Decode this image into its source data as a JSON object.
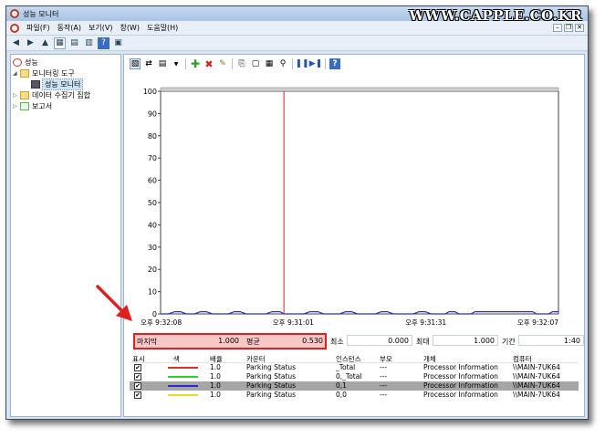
{
  "window": {
    "title": "성능 모니터"
  },
  "watermark": "WWW.CAPPLE.CO.KR",
  "menu": [
    "파일(F)",
    "동작(A)",
    "보기(V)",
    "창(W)",
    "도움말(H)"
  ],
  "tree": {
    "items": [
      {
        "label": "성능",
        "level": 0,
        "icon": "performance-icon"
      },
      {
        "label": "모니터링 도구",
        "level": 1,
        "icon": "folder-icon"
      },
      {
        "label": "성능 모니터",
        "level": 2,
        "icon": "monitor-icon",
        "selected": true
      },
      {
        "label": "데이터 수집기 집합",
        "level": 1,
        "icon": "collector-icon"
      },
      {
        "label": "보고서",
        "level": 1,
        "icon": "report-icon"
      }
    ]
  },
  "stats": {
    "last_label": "마지막",
    "last_value": "1.000",
    "avg_label": "평균",
    "avg_value": "0.530",
    "min_label": "최소",
    "min_value": "0.000",
    "max_label": "최대",
    "max_value": "1.000",
    "duration_label": "기간",
    "duration_value": "1:40"
  },
  "counters": {
    "headers": [
      "표시",
      "색",
      "배율",
      "카운터",
      "인스턴스",
      "부모",
      "개체",
      "컴퓨터"
    ],
    "rows": [
      {
        "show": true,
        "color": "#e03030",
        "scale": "1.0",
        "counter": "Parking Status",
        "instance": "_Total",
        "parent": "---",
        "object": "Processor Information",
        "computer": "\\\\MAIN-7UK64"
      },
      {
        "show": true,
        "color": "#33cc33",
        "scale": "1.0",
        "counter": "Parking Status",
        "instance": "0,_Total",
        "parent": "---",
        "object": "Processor Information",
        "computer": "\\\\MAIN-7UK64"
      },
      {
        "show": true,
        "color": "#2b2bd0",
        "scale": "1.0",
        "counter": "Parking Status",
        "instance": "0,1",
        "parent": "---",
        "object": "Processor Information",
        "computer": "\\\\MAIN-7UK64",
        "selected": true
      },
      {
        "show": true,
        "color": "#e0e020",
        "scale": "1.0",
        "counter": "Parking Status",
        "instance": "0,0",
        "parent": "---",
        "object": "Processor Information",
        "computer": "\\\\MAIN-7UK64"
      }
    ]
  },
  "chart_data": {
    "type": "line",
    "ylim": [
      0,
      100
    ],
    "yticks": [
      0,
      10,
      20,
      30,
      40,
      50,
      60,
      70,
      80,
      90,
      100
    ],
    "x_ticks": [
      "오후 9:32:08",
      "오후 9:31:01",
      "오후 9:31:31",
      "오후 9:32:07"
    ],
    "current_time_fraction": 0.31,
    "series": [
      {
        "color": "#2b2bd0",
        "points": [
          [
            0.0,
            0
          ],
          [
            0.02,
            0
          ],
          [
            0.035,
            1
          ],
          [
            0.05,
            1
          ],
          [
            0.065,
            0
          ],
          [
            0.085,
            0
          ],
          [
            0.1,
            1
          ],
          [
            0.115,
            1
          ],
          [
            0.13,
            0
          ],
          [
            0.17,
            0
          ],
          [
            0.185,
            1
          ],
          [
            0.2,
            1
          ],
          [
            0.215,
            0
          ],
          [
            0.265,
            0
          ],
          [
            0.28,
            1
          ],
          [
            0.3,
            1
          ],
          [
            0.31,
            0
          ],
          [
            0.36,
            0
          ],
          [
            0.375,
            1
          ],
          [
            0.395,
            1
          ],
          [
            0.41,
            0
          ],
          [
            0.45,
            0
          ],
          [
            0.465,
            1
          ],
          [
            0.48,
            1
          ],
          [
            0.495,
            0
          ],
          [
            0.54,
            0
          ],
          [
            0.555,
            1
          ],
          [
            0.57,
            1
          ],
          [
            0.585,
            0
          ],
          [
            0.635,
            0
          ],
          [
            0.65,
            1
          ],
          [
            0.665,
            1
          ],
          [
            0.68,
            0
          ],
          [
            0.715,
            0
          ],
          [
            0.725,
            1
          ],
          [
            0.74,
            1
          ],
          [
            0.75,
            0
          ],
          [
            0.78,
            0
          ],
          [
            0.79,
            1
          ],
          [
            0.935,
            1
          ],
          [
            0.945,
            0
          ],
          [
            0.975,
            0
          ],
          [
            0.985,
            1
          ],
          [
            1.0,
            1
          ]
        ]
      }
    ]
  }
}
